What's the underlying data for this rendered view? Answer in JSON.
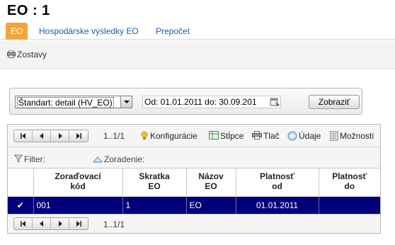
{
  "page": {
    "title": "EO : 1"
  },
  "tabs": [
    {
      "label": "EO",
      "active": true
    },
    {
      "label": "Hospodárske výsledky EO",
      "active": false
    },
    {
      "label": "Prepočet",
      "active": false
    }
  ],
  "subbar": {
    "zostavy_label": "Zostavy"
  },
  "filter": {
    "report_select_value": "Štandart: detail (HV_EO)",
    "date_range_value": "Od: 01.01.2011 do: 30.09.201",
    "show_button_label": "Zobraziť"
  },
  "grid": {
    "page_info": "1..1/1",
    "toolbar": {
      "configure_label": "Konfigurácie",
      "columns_label": "Stĺpce",
      "print_label": "Tlač",
      "data_label": "Údaje",
      "options_label": "Možnosti"
    },
    "filter_label": "Filter:",
    "sort_label": "Zoradenie:",
    "columns": [
      {
        "line1": "Zoraďovací",
        "line2": "kód"
      },
      {
        "line1": "Skratka",
        "line2": "EO"
      },
      {
        "line1": "Názov",
        "line2": "EO"
      },
      {
        "line1": "Platnosť",
        "line2": "od"
      },
      {
        "line1": "Platnosť",
        "line2": "do"
      }
    ],
    "rows": [
      {
        "check": "✔",
        "code": "001",
        "short": "1",
        "name": "EO",
        "valid_from": "01.01.2011",
        "valid_to": ""
      }
    ],
    "footer_page_info": "1..1/1"
  },
  "colors": {
    "tab_active": "#f5a43a",
    "link": "#1e5aa8",
    "row_selected": "#00007b"
  }
}
